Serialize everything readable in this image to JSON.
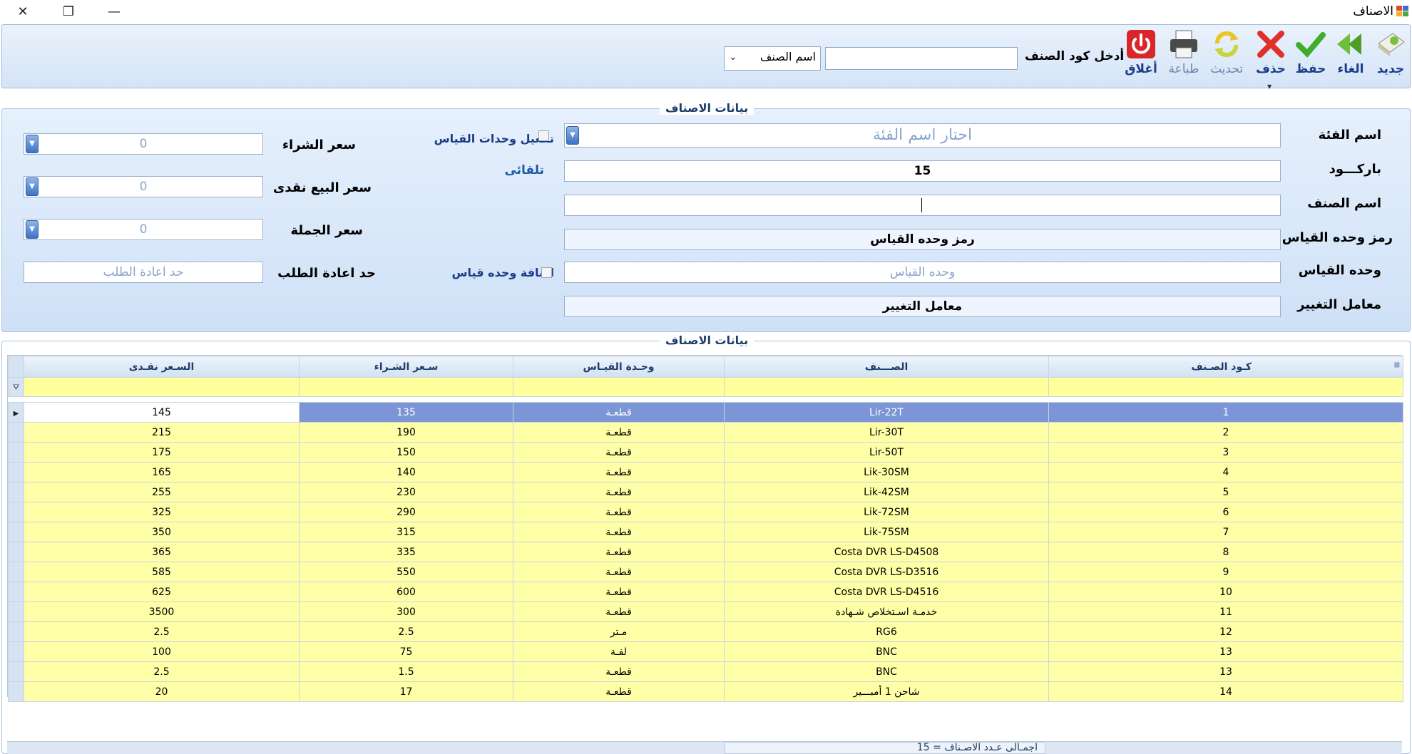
{
  "window": {
    "title": "الاصناف"
  },
  "toolbar": {
    "buttons": {
      "new": "جديد",
      "undo": "الغاء",
      "save": "حفظ",
      "delete": "حذف",
      "refresh": "تحديث",
      "print": "طباعة",
      "close": "أغلاق"
    },
    "code_label": "أدخل كود الصنف",
    "code_value": "",
    "search_by": "اسم الصنف"
  },
  "form": {
    "title": "بيانات الاصناف",
    "labels": {
      "category": "اسم الفئة",
      "barcode": "باركـــود",
      "item_name": "اسم الصنف",
      "unit_symbol": "رمز وحده القياس",
      "unit": "وحده القياس",
      "factor": "معامل التغيير",
      "purchase_price": "سعر الشراء",
      "cash_price": "سعر البيع نقدى",
      "wholesale_price": "سعر الجملة",
      "reorder_limit": "حد اعادة الطلب",
      "enable_units": "تفعيل وحدات القياس",
      "add_unit": "اضافة وحده قياس",
      "auto": "تلقائى"
    },
    "values": {
      "category": "احتار اسم الفئة",
      "barcode": "15",
      "item_name": "",
      "unit_symbol": "رمز وحده القياس",
      "unit": "وحده القياس",
      "factor": "معامل التغيير",
      "purchase_price": "0",
      "cash_price": "0",
      "wholesale_price": "0",
      "reorder_limit": "حد اعادة الطلب"
    }
  },
  "grid": {
    "title": "بيانات الاصناف",
    "columns": [
      "كـود الصـنف",
      "الصـــنف",
      "وحـدة القيـاس",
      "سـعر الشـراء",
      "السـعر نقـدى"
    ],
    "rows": [
      [
        "1",
        "Lir-22T",
        "قطعـة",
        "135",
        "145"
      ],
      [
        "2",
        "Lir-30T",
        "قطعـة",
        "190",
        "215"
      ],
      [
        "3",
        "Lir-50T",
        "قطعـة",
        "150",
        "175"
      ],
      [
        "4",
        "Lik-30SM",
        "قطعـة",
        "140",
        "165"
      ],
      [
        "5",
        "Lik-42SM",
        "قطعـة",
        "230",
        "255"
      ],
      [
        "6",
        "Lik-72SM",
        "قطعـة",
        "290",
        "325"
      ],
      [
        "7",
        "Lik-75SM",
        "قطعـة",
        "315",
        "350"
      ],
      [
        "8",
        "Costa DVR LS-D4508",
        "قطعـة",
        "335",
        "365"
      ],
      [
        "9",
        "Costa DVR LS-D3516",
        "قطعـة",
        "550",
        "585"
      ],
      [
        "10",
        "Costa DVR LS-D4516",
        "قطعـة",
        "600",
        "625"
      ],
      [
        "11",
        "خدمـة اسـتخلاص شـهادة",
        "قطعـة",
        "300",
        "3500"
      ],
      [
        "12",
        "RG6",
        "مـتر",
        "2.5",
        "2.5"
      ],
      [
        "13",
        "BNC",
        "لفـة",
        "75",
        "100"
      ],
      [
        "13",
        "BNC",
        "قطعـة",
        "1.5",
        "2.5"
      ],
      [
        "14",
        "شاحن 1 أمبـــير",
        "قطعـة",
        "17",
        "20"
      ]
    ],
    "selected_row": 0,
    "status": "اجمـالى عـدد الاصـناف = 15"
  },
  "colors": {
    "accent": "#1a3e8a",
    "row_fill": "#ffffa8",
    "selected": "#7b95d6"
  }
}
